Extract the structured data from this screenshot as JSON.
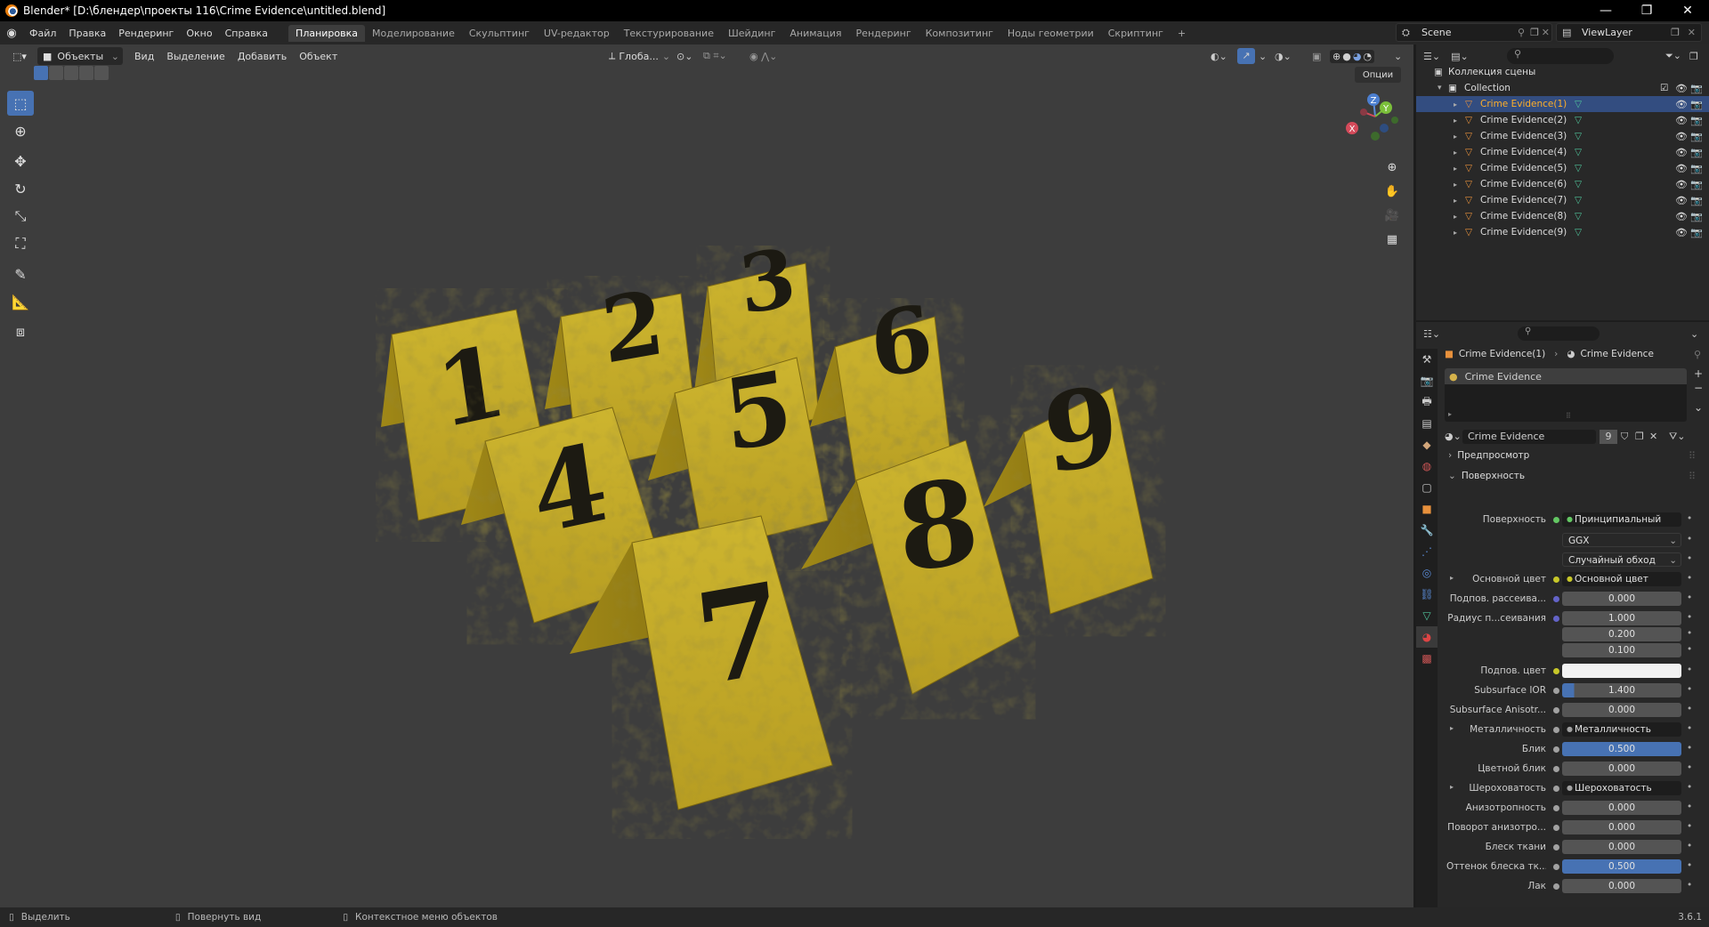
{
  "titlebar": {
    "title": "Blender* [D:\\блендер\\проекты 116\\Crime Evidence\\untitled.blend]",
    "minimize": "—",
    "restore": "❐",
    "close": "✕"
  },
  "menu": [
    "Файл",
    "Правка",
    "Рендеринг",
    "Окно",
    "Справка"
  ],
  "workspaces": [
    "Планировка",
    "Моделирование",
    "Скульптинг",
    "UV-редактор",
    "Текстурирование",
    "Шейдинг",
    "Анимация",
    "Рендеринг",
    "Композитинг",
    "Ноды геометрии",
    "Скриптинг",
    "+"
  ],
  "scene": "Scene",
  "view_layer": "ViewLayer",
  "viewport": {
    "mode": "Объекты",
    "menus": [
      "Вид",
      "Выделение",
      "Добавить",
      "Объект"
    ],
    "orientation": "Глоба...",
    "options": "Опции",
    "gizmo": {
      "x": "X",
      "y": "Y",
      "z": "Z"
    }
  },
  "evidence_markers": [
    "1",
    "2",
    "3",
    "4",
    "5",
    "6",
    "7",
    "8",
    "9"
  ],
  "outliner": {
    "scene_collection": "Коллекция сцены",
    "collection": "Collection",
    "items": [
      "Crime Evidence(1)",
      "Crime Evidence(2)",
      "Crime Evidence(3)",
      "Crime Evidence(4)",
      "Crime Evidence(5)",
      "Crime Evidence(6)",
      "Crime Evidence(7)",
      "Crime Evidence(8)",
      "Crime Evidence(9)"
    ],
    "selected_index": 0
  },
  "properties": {
    "breadcrumb_object": "Crime Evidence(1)",
    "breadcrumb_material": "Crime Evidence",
    "slot": "Crime Evidence",
    "material_name": "Crime Evidence",
    "users": "9",
    "panel_preview": "Предпросмотр",
    "panel_surface": "Поверхность",
    "rows": [
      {
        "label": "Поверхность",
        "value": "Принципиальный BSDF",
        "type": "link",
        "dot": "#63c763"
      },
      {
        "label": "",
        "value": "GGX",
        "type": "dropdown"
      },
      {
        "label": "",
        "value": "Случайный обход",
        "type": "dropdown"
      },
      {
        "label": "Основной цвет",
        "value": "Основной цвет",
        "type": "link",
        "dot": "#c7c729",
        "expand": true
      },
      {
        "label": "Подпов. рассеива...",
        "value": "0.000",
        "type": "num",
        "dot": "#6363c7"
      },
      {
        "label": "Радиус п...сеивания",
        "value": "1.000",
        "type": "num",
        "dot": "#6363c7"
      },
      {
        "label": "",
        "value": "0.200",
        "type": "num"
      },
      {
        "label": "",
        "value": "0.100",
        "type": "num"
      },
      {
        "label": "Подпов. цвет",
        "value": "",
        "type": "color",
        "dot": "#c7c729"
      },
      {
        "label": "Subsurface IOR",
        "value": "1.400",
        "type": "num",
        "dot": "#a1a1a1",
        "fill": 0.1
      },
      {
        "label": "Subsurface Anisotr...",
        "value": "0.000",
        "type": "num",
        "dot": "#a1a1a1"
      },
      {
        "label": "Металличность",
        "value": "Металличность",
        "type": "link",
        "dot": "#a1a1a1",
        "expand": true
      },
      {
        "label": "Блик",
        "value": "0.500",
        "type": "num",
        "dot": "#a1a1a1",
        "fill": 1.0
      },
      {
        "label": "Цветной блик",
        "value": "0.000",
        "type": "num",
        "dot": "#a1a1a1"
      },
      {
        "label": "Шероховатость",
        "value": "Шероховатость",
        "type": "link",
        "dot": "#a1a1a1",
        "expand": true
      },
      {
        "label": "Анизотропность",
        "value": "0.000",
        "type": "num",
        "dot": "#a1a1a1"
      },
      {
        "label": "Поворот анизотро...",
        "value": "0.000",
        "type": "num",
        "dot": "#a1a1a1"
      },
      {
        "label": "Блеск ткани",
        "value": "0.000",
        "type": "num",
        "dot": "#a1a1a1"
      },
      {
        "label": "Оттенок блеска тк...",
        "value": "0.500",
        "type": "num",
        "dot": "#a1a1a1",
        "fill": 1.0
      },
      {
        "label": "Лак",
        "value": "0.000",
        "type": "num",
        "dot": "#a1a1a1"
      }
    ]
  },
  "statusbar": {
    "select": "Выделить",
    "rotate": "Повернуть вид",
    "context": "Контекстное меню объектов",
    "version": "3.6.1"
  },
  "colors": {
    "accent": "#4772b3",
    "selected_row": "#334d80",
    "marker_yellow": "#c9b12a",
    "mesh_orange": "#e8913c",
    "mesh_data_green": "#4fc39a"
  }
}
